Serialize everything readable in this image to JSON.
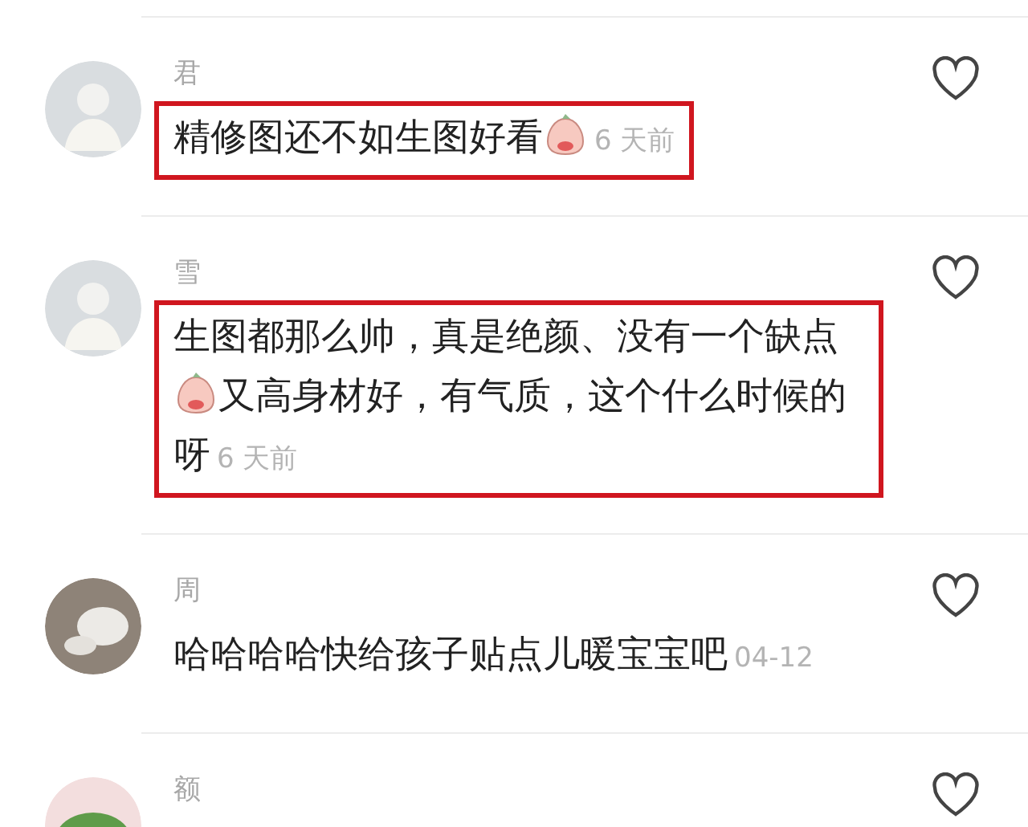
{
  "comments": [
    {
      "avatar": {
        "kind": "person"
      },
      "name": "君",
      "highlighted": true,
      "time": "6 天前",
      "content": [
        {
          "kind": "text",
          "text": "精修图还不如生图好看"
        },
        {
          "kind": "emoji"
        }
      ]
    },
    {
      "avatar": {
        "kind": "person"
      },
      "name": "雪",
      "highlighted": true,
      "time": "6 天前",
      "content": [
        {
          "kind": "text",
          "text": "生图都那么帅，真是绝颜、没有一个缺点"
        },
        {
          "kind": "emoji"
        },
        {
          "kind": "text",
          "text": "又高身材好，有气质，这个什么时候的呀"
        }
      ]
    },
    {
      "avatar": {
        "kind": "cat"
      },
      "name": "周",
      "time": "04-12",
      "content": [
        {
          "kind": "text",
          "text": "哈哈哈哈快给孩子贴点儿暖宝宝吧"
        }
      ]
    },
    {
      "avatar": {
        "kind": "green"
      },
      "name": "额"
    }
  ]
}
